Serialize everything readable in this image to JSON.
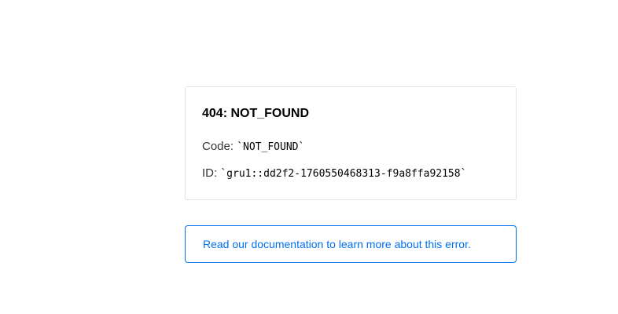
{
  "error": {
    "status_code": "404",
    "separator": ": ",
    "status_text": "NOT_FOUND",
    "code_label": "Code: ",
    "code_value": "`NOT_FOUND`",
    "id_label": "ID: ",
    "id_value": "`gru1::dd2f2-1760550468313-f9a8ffa92158`"
  },
  "help": {
    "link_text": "Read our documentation to learn more about this error."
  },
  "colors": {
    "link": "#0070f3",
    "card_border": "#e3e3e3"
  }
}
